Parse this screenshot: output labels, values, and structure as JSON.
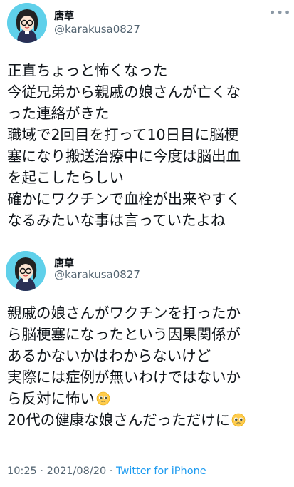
{
  "tweets": [
    {
      "author": {
        "name": "唐草",
        "handle": "@karakusa0827",
        "avatar": "avatar-illustration"
      },
      "more_icon": "more-horizontal-icon",
      "lines": [
        "正直ちょっと怖くなった",
        "今従兄弟から親戚の娘さんが亡くな",
        "った連絡がきた",
        "職域で2回目を打って10日目に脳梗",
        "塞になり搬送治療中に今度は脳出血",
        "を起こしたらしい",
        "確かにワクチンで血栓が出来やすく",
        "なるみたいな事は言っていたよね"
      ]
    },
    {
      "author": {
        "name": "唐草",
        "handle": "@karakusa0827",
        "avatar": "avatar-illustration"
      },
      "more_icon": "more-horizontal-icon",
      "lines": [
        "親戚の娘さんがワクチンを打ったか",
        "ら脳梗塞になったという因果関係が",
        "あるかないかはわからないけど",
        "実際には症例が無いわけではないか",
        "ら反対に怖い",
        "20代の健康な娘さんだっただけに"
      ],
      "emoji": "pleading-face-icon",
      "meta": {
        "time": "10:25 · 2021/08/20 · ",
        "source": "Twitter for iPhone"
      }
    }
  ]
}
